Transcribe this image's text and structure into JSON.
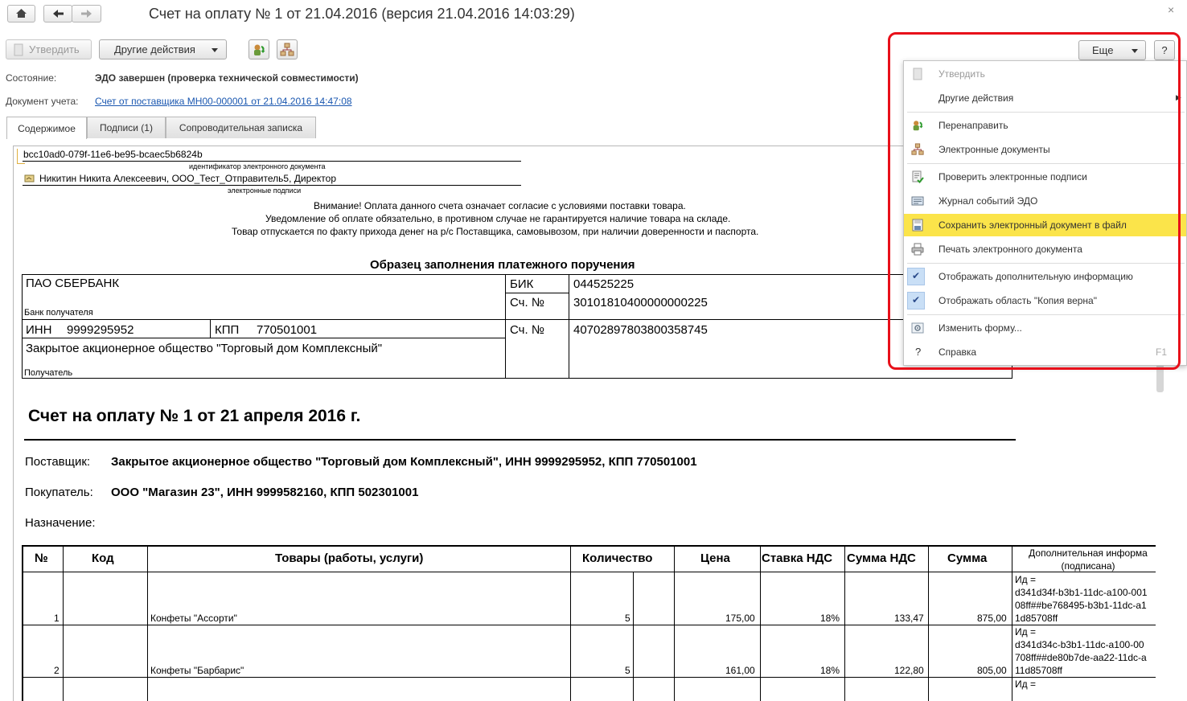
{
  "window": {
    "title": "Счет на оплату № 1 от 21.04.2016 (версия 21.04.2016 14:03:29)",
    "close_glyph": "×"
  },
  "toolbar": {
    "approve_label": "Утвердить",
    "other_actions_label": "Другие действия",
    "more_label": "Еще",
    "help_label": "?"
  },
  "info": {
    "state_label": "Состояние:",
    "state_value": "ЭДО завершен (проверка технической совместимости)",
    "account_doc_label": "Документ учета:",
    "account_doc_link": "Счет от поставщика МН00-000001 от 21.04.2016 14:47:08"
  },
  "tabs": [
    {
      "label": "Содержимое",
      "active": true
    },
    {
      "label": "Подписи (1)",
      "active": false
    },
    {
      "label": "Сопроводительная записка",
      "active": false
    }
  ],
  "document": {
    "doc_id": "bcc10ad0-079f-11e6-be95-bcaec5b6824b",
    "doc_id_caption": "идентификатор электронного документа",
    "signer": "Никитин Никита Алексеевич, ООО_Тест_Отправитель5, Директор",
    "signer_caption": "электронные подписи",
    "notice": [
      "Внимание!  Оплата данного счета означает согласие с условиями поставки товара.",
      "Уведомление об оплате обязательно, в противном случае не гарантируется наличие товара на складе.",
      "Товар отпускается по факту прихода денег на р/с Поставщика, самовывозом, при наличии доверенности и паспорта."
    ],
    "payment_title": "Образец заполнения платежного поручения",
    "bank_name": "ПАО СБЕРБАНК",
    "bank_caption": "Банк получателя",
    "bik_label": "БИК",
    "bik_value": "044525225",
    "corr_label": "Сч. №",
    "corr_value": "30101810400000000225",
    "inn_label": "ИНН",
    "inn_value": "9999295952",
    "kpp_label": "КПП",
    "kpp_value": "770501001",
    "acc_label": "Сч. №",
    "acc_value": "40702897803800358745",
    "recipient_name": "Закрытое акционерное общество \"Торговый дом Комплексный\"",
    "recipient_caption": "Получатель",
    "invoice_title": "Счет на оплату № 1 от 21 апреля 2016 г.",
    "supplier_label": "Поставщик:",
    "supplier_value": "Закрытое акционерное общество \"Торговый дом Комплексный\", ИНН 9999295952, КПП 770501001",
    "buyer_label": "Покупатель:",
    "buyer_value": "ООО \"Магазин 23\", ИНН 9999582160, КПП 502301001",
    "purpose_label": "Назначение:",
    "table": {
      "headers": [
        "№",
        "Код",
        "Товары (работы, услуги)",
        "Количество",
        "Цена",
        "Ставка НДС",
        "Сумма НДС",
        "Сумма",
        "Дополнительная информа (подписана)"
      ],
      "rows": [
        {
          "n": "1",
          "code": "",
          "name": "Конфеты \"Ассорти\"",
          "qty": "5",
          "price": "175,00",
          "vat_rate": "18%",
          "vat_sum": "133,47",
          "sum": "875,00",
          "extra": [
            "Ид =",
            "d341d34f-b3b1-11dc-a100-001",
            "08ff##be768495-b3b1-11dc-a1",
            "1d85708ff"
          ]
        },
        {
          "n": "2",
          "code": "",
          "name": "Конфеты \"Барбарис\"",
          "qty": "5",
          "price": "161,00",
          "vat_rate": "18%",
          "vat_sum": "122,80",
          "sum": "805,00",
          "extra": [
            "Ид =",
            "d341d34c-b3b1-11dc-a100-00",
            "708ff##de80b7de-aa22-11dc-a",
            "11d85708ff"
          ]
        }
      ],
      "row3_extra": "Ид ="
    }
  },
  "menu": {
    "items": [
      {
        "label": "Утвердить",
        "icon": "document-icon",
        "disabled": true
      },
      {
        "label": "Другие действия",
        "icon": "",
        "submenu": true
      },
      {
        "label": "Перенаправить",
        "icon": "redirect-icon"
      },
      {
        "label": "Электронные документы",
        "icon": "hierarchy-icon"
      },
      {
        "label": "Проверить электронные подписи",
        "icon": "check-signature-icon"
      },
      {
        "label": "Журнал событий ЭДО",
        "icon": "event-log-icon"
      },
      {
        "label": "Сохранить электронный документ в файл",
        "icon": "save-file-icon",
        "highlighted": true
      },
      {
        "label": "Печать электронного документа",
        "icon": "printer-icon"
      },
      {
        "label": "Отображать дополнительную информацию",
        "icon": "checkmark-icon",
        "checked": true
      },
      {
        "label": "Отображать область \"Копия верна\"",
        "icon": "checkmark-icon",
        "checked": true
      },
      {
        "label": "Изменить форму...",
        "icon": "form-settings-icon"
      },
      {
        "label": "Справка",
        "icon": "help-icon",
        "shortcut": "F1"
      }
    ],
    "help_glyph": "?",
    "check_glyph": "✔",
    "submenu_glyph": "▶"
  },
  "colors": {
    "highlight": "#fbe44a",
    "annotation_frame": "#e8101a",
    "link": "#1a57b0"
  }
}
